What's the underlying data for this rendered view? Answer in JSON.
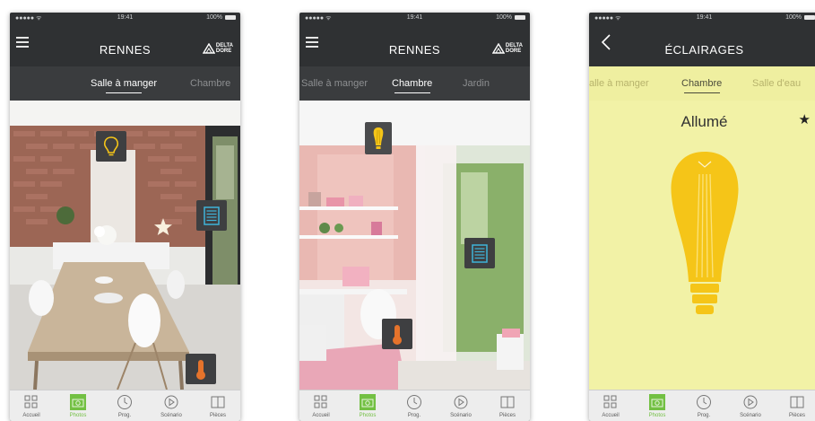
{
  "status_bar": {
    "signal": "●●●●● ᯤ",
    "time": "19:41",
    "battery": "100%"
  },
  "phones": [
    {
      "title": "RENNES",
      "logo": {
        "line1": "DELTA",
        "line2": "DORE"
      },
      "tabs": [
        "Salle à manger",
        "Chambre"
      ],
      "active_tab": "Salle à manger"
    },
    {
      "title": "RENNES",
      "logo": {
        "line1": "DELTA",
        "line2": "DORE"
      },
      "tabs": [
        "Salle à manger",
        "Chambre",
        "Jardin"
      ],
      "active_tab": "Chambre"
    },
    {
      "title": "ÉCLAIRAGES",
      "tabs": [
        "alle à manger",
        "Chambre",
        "Salle d'eau"
      ],
      "active_tab": "Chambre",
      "state": "Allumé",
      "lamp_color": "#f5c518"
    }
  ],
  "tabbar": [
    {
      "icon": "grid-icon",
      "label": "Accueil"
    },
    {
      "icon": "camera-icon",
      "label": "Photos"
    },
    {
      "icon": "clock-icon",
      "label": "Prog."
    },
    {
      "icon": "play-icon",
      "label": "Scénario"
    },
    {
      "icon": "door-icon",
      "label": "Pièces"
    }
  ],
  "active_tabbar": "Photos",
  "colors": {
    "accent_green": "#73c043",
    "device_square": "#3e3f41",
    "lamp_yellow": "#f5c518",
    "lamp_panel": "#f2f2a6"
  }
}
